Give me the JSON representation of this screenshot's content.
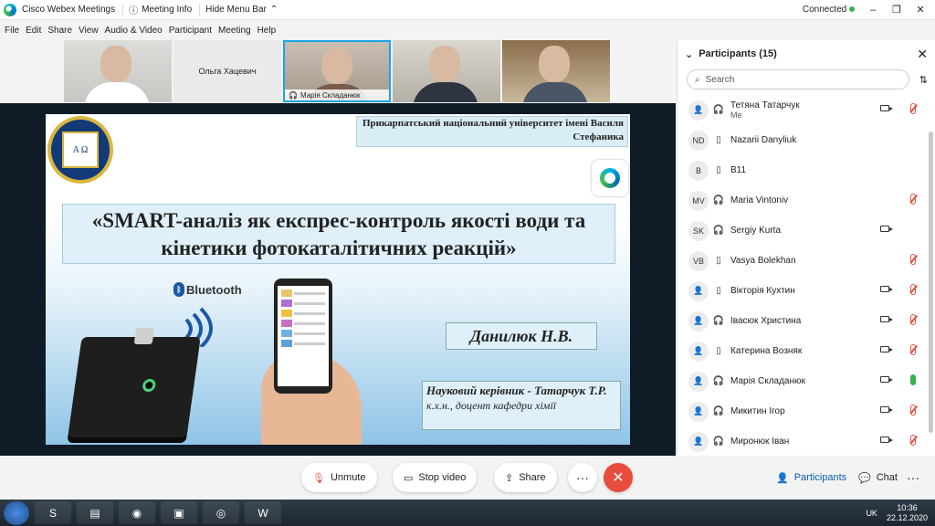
{
  "titlebar": {
    "app_name": "Cisco Webex Meetings",
    "meeting_info": "Meeting Info",
    "hide_menu_bar": "Hide Menu Bar",
    "status": "Connected",
    "minimize": "–",
    "restore": "❐",
    "close": "✕"
  },
  "menu": {
    "file": "File",
    "edit": "Edit",
    "share": "Share",
    "view": "View",
    "audio_video": "Audio & Video",
    "participant": "Participant",
    "meeting": "Meeting",
    "help": "Help"
  },
  "thumbnails": [
    {
      "name": ""
    },
    {
      "name": "Ольга Хацевич"
    },
    {
      "name": "Марія Складанюк"
    },
    {
      "name": ""
    },
    {
      "name": ""
    }
  ],
  "slide": {
    "university": "Прикарпатський національний університет імені Василя Стефаника",
    "seal_text": "Α Ω",
    "title": "«SMART-аналіз як експрес-контроль якості води та кінетики фотокаталітичних реакцій»",
    "bluetooth": "Bluetooth",
    "author": "Данилюк Н.В.",
    "advisor_label": "Науковий керівник - Татарчук Т.Р.",
    "advisor_title": "к.х.н., доцент кафедри хімії"
  },
  "participants": {
    "title": "Participants (15)",
    "search_placeholder": "Search",
    "list": [
      {
        "avatar": "",
        "name": "Тетяна Татарчук",
        "sub": "Me",
        "device": "headset",
        "camera": true,
        "mic": "off"
      },
      {
        "avatar": "ND",
        "name": "Nazarii Danyliuk",
        "sub": "",
        "device": "phone",
        "camera": false,
        "mic": "none"
      },
      {
        "avatar": "B",
        "name": "B11",
        "sub": "",
        "device": "phone",
        "camera": false,
        "mic": "none"
      },
      {
        "avatar": "MV",
        "name": "Maria Vintoniv",
        "sub": "",
        "device": "headset",
        "camera": false,
        "mic": "off"
      },
      {
        "avatar": "SK",
        "name": "Sergiy Kurta",
        "sub": "",
        "device": "headset",
        "camera": true,
        "mic": "none"
      },
      {
        "avatar": "VB",
        "name": "Vasya Bolekhan",
        "sub": "",
        "device": "phone",
        "camera": false,
        "mic": "off"
      },
      {
        "avatar": "",
        "name": "Вікторія Кухтин",
        "sub": "",
        "device": "phone",
        "camera": true,
        "mic": "off"
      },
      {
        "avatar": "",
        "name": "Івасюк Христина",
        "sub": "",
        "device": "headset",
        "camera": true,
        "mic": "off"
      },
      {
        "avatar": "",
        "name": "Катерина Возняк",
        "sub": "",
        "device": "phone",
        "camera": true,
        "mic": "off"
      },
      {
        "avatar": "",
        "name": "Марія Складанюк",
        "sub": "",
        "device": "headset",
        "camera": true,
        "mic": "on"
      },
      {
        "avatar": "",
        "name": "Микитин Ігор",
        "sub": "",
        "device": "headset",
        "camera": true,
        "mic": "off"
      },
      {
        "avatar": "",
        "name": "Миронюк Іван",
        "sub": "",
        "device": "headset",
        "camera": true,
        "mic": "off"
      }
    ]
  },
  "controls": {
    "unmute": "Unmute",
    "stop_video": "Stop video",
    "share": "Share",
    "more": "···",
    "end": "✕",
    "participants": "Participants",
    "chat": "Chat"
  },
  "taskbar": {
    "lang": "UK",
    "time": "10:36",
    "date": "22.12.2020"
  },
  "colors": {
    "accent": "#0a5ea8",
    "end_call": "#e84c3d",
    "connected": "#35b34a",
    "muted": "#e3503e"
  }
}
